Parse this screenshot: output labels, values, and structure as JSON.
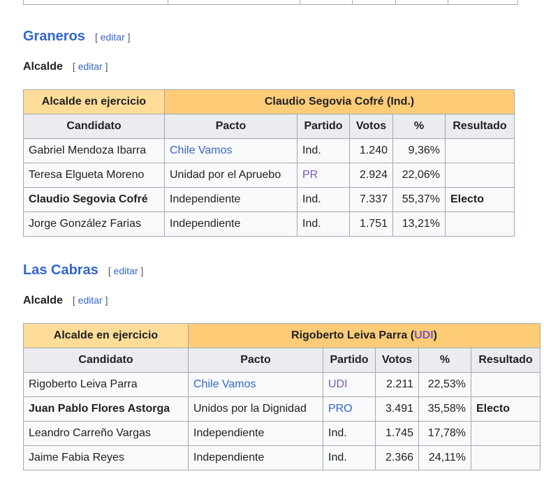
{
  "sections": [
    {
      "heading": "Graneros",
      "edit_label": "editar",
      "sub_heading": "Alcalde",
      "sub_edit_label": "editar",
      "incumbent_label": "Alcalde en ejercicio",
      "incumbent_name": "Claudio Segovia Cofré (Ind.)",
      "columns": [
        "Candidato",
        "Pacto",
        "Partido",
        "Votos",
        "%",
        "Resultado"
      ],
      "rows": [
        {
          "candidato": "Gabriel Mendoza Ibarra",
          "pacto": "Chile Vamos",
          "partido": "Ind.",
          "votos": "1.240",
          "pct": "9,36%",
          "resultado": ""
        },
        {
          "candidato": "Teresa Elgueta Moreno",
          "pacto": "Unidad por el Apruebo",
          "partido": "PR",
          "votos": "2.924",
          "pct": "22,06%",
          "resultado": ""
        },
        {
          "candidato": "Claudio Segovia Cofré",
          "pacto": "Independiente",
          "partido": "Ind.",
          "votos": "7.337",
          "pct": "55,37%",
          "resultado": "Electo"
        },
        {
          "candidato": "Jorge González Farias",
          "pacto": "Independiente",
          "partido": "Ind.",
          "votos": "1.751",
          "pct": "13,21%",
          "resultado": ""
        }
      ]
    },
    {
      "heading": "Las Cabras",
      "edit_label": "editar",
      "sub_heading": "Alcalde",
      "sub_edit_label": "editar",
      "incumbent_label": "Alcalde en ejercicio",
      "incumbent_name_prefix": "Rigoberto Leiva Parra (",
      "incumbent_party": "UDI",
      "incumbent_name_suffix": ")",
      "columns": [
        "Candidato",
        "Pacto",
        "Partido",
        "Votos",
        "%",
        "Resultado"
      ],
      "rows": [
        {
          "candidato": "Rigoberto Leiva Parra",
          "pacto": "Chile Vamos",
          "partido": "UDI",
          "votos": "2.211",
          "pct": "22,53%",
          "resultado": ""
        },
        {
          "candidato": "Juan Pablo Flores Astorga",
          "pacto": "Unidos por la Dignidad",
          "partido": "PRO",
          "votos": "3.491",
          "pct": "35,58%",
          "resultado": "Electo"
        },
        {
          "candidato": "Leandro Carreño Vargas",
          "pacto": "Independiente",
          "partido": "Ind.",
          "votos": "1.745",
          "pct": "17,78%",
          "resultado": ""
        },
        {
          "candidato": "Jaime Fabia Reyes",
          "pacto": "Independiente",
          "partido": "Ind.",
          "votos": "2.366",
          "pct": "24,11%",
          "resultado": ""
        }
      ]
    }
  ],
  "colors": {
    "link": "#3366cc",
    "party_link": "#795cb2",
    "incumbent_bg": "#ffdd99",
    "winner_bg": "#fecc77",
    "header_bg": "#eaecf0"
  }
}
